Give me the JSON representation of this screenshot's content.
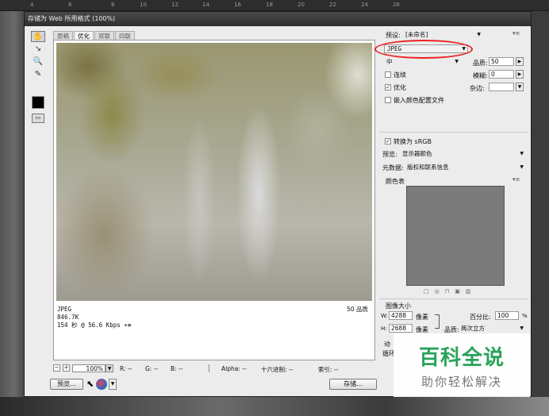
{
  "ruler": [
    "4",
    "6",
    "8",
    "10",
    "12",
    "14",
    "16",
    "18",
    "20",
    "22",
    "24",
    "26"
  ],
  "dialog": {
    "title": "存储为 Web 所用格式 (100%)"
  },
  "tabs": [
    "原稿",
    "优化",
    "双联",
    "四联"
  ],
  "preview": {
    "format": "JPEG",
    "size": "846.7K",
    "time": "154 秒 @ 56.6 Kbps",
    "time_menu": "▾≡",
    "quality": "50 品质"
  },
  "statusbar": {
    "zoom_out": "−",
    "zoom_in": "+",
    "zoom": "100%",
    "r": "R: --",
    "g": "G: --",
    "b": "B: --",
    "alpha": "Alpha: --",
    "hex": "十六进制: --",
    "index": "索引: --"
  },
  "buttons": {
    "preview": "预览...",
    "save": "存储..."
  },
  "panel": {
    "preset_label": "预设:",
    "preset_value": "[未命名]",
    "format": "JPEG",
    "quality_level": "中",
    "quality_label": "品质:",
    "quality_value": "50",
    "progressive": "连续",
    "blur_label": "模糊:",
    "blur_value": "0",
    "optimized": "优化",
    "matte_label": "杂边:",
    "embed_profile": "嵌入颜色配置文件",
    "convert_srgb": "转换为 sRGB",
    "preview_label": "预览:",
    "preview_value": "显示器颜色",
    "metadata_label": "元数据:",
    "metadata_value": "版权和联系信息",
    "color_table_label": "颜色表",
    "image_size_label": "图像大小",
    "w_label": "W:",
    "w_value": "4288",
    "h_label": "H:",
    "h_value": "2688",
    "unit": "像素",
    "percent_label": "百分比:",
    "percent_value": "100",
    "percent_unit": "%",
    "resample_label": "品质:",
    "resample_value": "两次立方",
    "anim_label": "动",
    "loop_label": "循环"
  },
  "watermark": {
    "title": "百科全说",
    "subtitle": "助你轻松解决"
  }
}
